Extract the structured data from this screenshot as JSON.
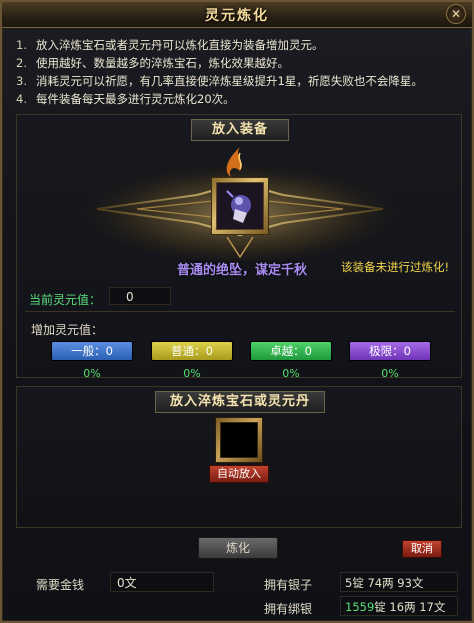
{
  "window": {
    "title": "灵元炼化",
    "close_glyph": "✕"
  },
  "rules": [
    {
      "num": "1.",
      "text": "放入淬炼宝石或者灵元丹可以炼化直接为装备增加灵元。"
    },
    {
      "num": "2.",
      "text": "使用越好、数量越多的淬炼宝石，炼化效果越好。"
    },
    {
      "num": "3.",
      "text": "消耗灵元可以祈愿，有几率直接使淬炼星级提升1星，祈愿失败也不会降星。"
    },
    {
      "num": "4.",
      "text": "每件装备每天最多进行灵元炼化20次。"
    }
  ],
  "equip_section": {
    "header": "放入装备",
    "item_name": "普通的绝坠，谋定千秋",
    "status_note": "该装备未进行过炼化!",
    "current_label": "当前灵元值：",
    "current_value": "0",
    "add_label": "增加灵元值：",
    "grades": [
      {
        "label": "一般：0",
        "pct": "0%",
        "color": "#3f74cc"
      },
      {
        "label": "普通：0",
        "pct": "0%",
        "color": "#c4b935"
      },
      {
        "label": "卓越：0",
        "pct": "0%",
        "color": "#36b653"
      },
      {
        "label": "极限：0",
        "pct": "0%",
        "color": "#8a50d2"
      }
    ]
  },
  "gem_section": {
    "header": "放入淬炼宝石或灵元丹",
    "auto_button": "自动放入"
  },
  "actions": {
    "refine": "炼化",
    "cancel": "取消"
  },
  "cost": {
    "label": "需要金钱",
    "value": "0文"
  },
  "money": {
    "silver_label": "拥有银子",
    "silver_value": "5锭 74两 93文",
    "bound_label": "拥有绑银",
    "bound_ding": "1559",
    "bound_rest": "锭 16两 17文"
  },
  "icons": {
    "equip_item": "jade-pendant-icon",
    "emblem": "flame-crest-icon"
  }
}
